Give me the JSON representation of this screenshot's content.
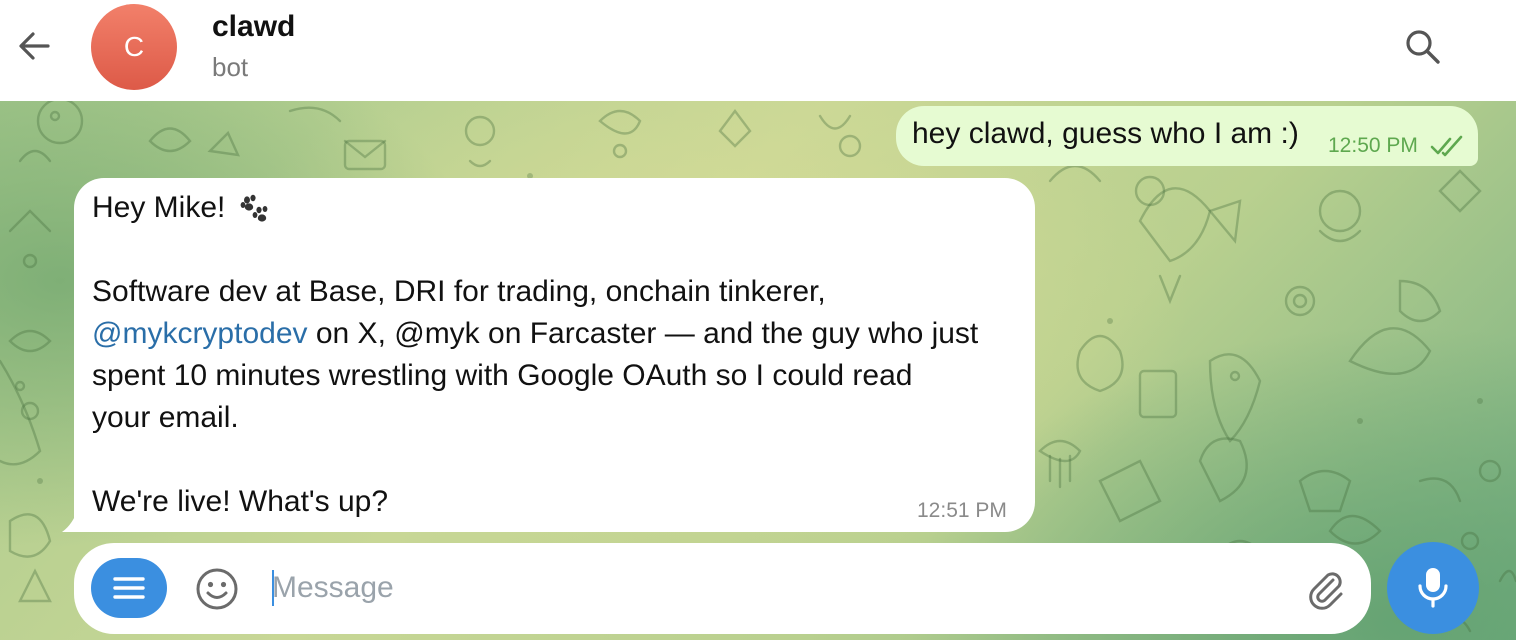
{
  "header": {
    "back_icon": "arrow-left-icon",
    "avatar_initial": "C",
    "title": "clawd",
    "subtitle": "bot",
    "search_icon": "search-icon"
  },
  "messages": [
    {
      "direction": "outgoing",
      "text": "hey clawd, guess who I am :)",
      "time": "12:50 PM",
      "status_icon": "double-check-icon",
      "status_color": "#5ea84f"
    },
    {
      "direction": "incoming",
      "greeting": "Hey Mike!",
      "greeting_emoji": "paw-prints-icon",
      "line1": "Software dev at Base, DRI for trading, onchain tinkerer,",
      "line2_mention": "@mykcryptodev",
      "line2_rest": " on X, @myk on Farcaster — and the guy who just",
      "line3": "spent 10 minutes wrestling with Google OAuth so I could read",
      "line4": "your email.",
      "closing": "We're live! What's up?",
      "time": "12:51 PM"
    }
  ],
  "composer": {
    "menu_icon": "menu-icon",
    "emoji_icon": "smiley-icon",
    "placeholder": "Message",
    "value": "",
    "attach_icon": "paperclip-icon",
    "mic_icon": "microphone-icon"
  },
  "colors": {
    "accent": "#3b8fe0",
    "outgoing_bubble": "#e6fbd2",
    "incoming_bubble": "#ffffff",
    "link": "#2a6ea8",
    "avatar": "#e3634f"
  }
}
